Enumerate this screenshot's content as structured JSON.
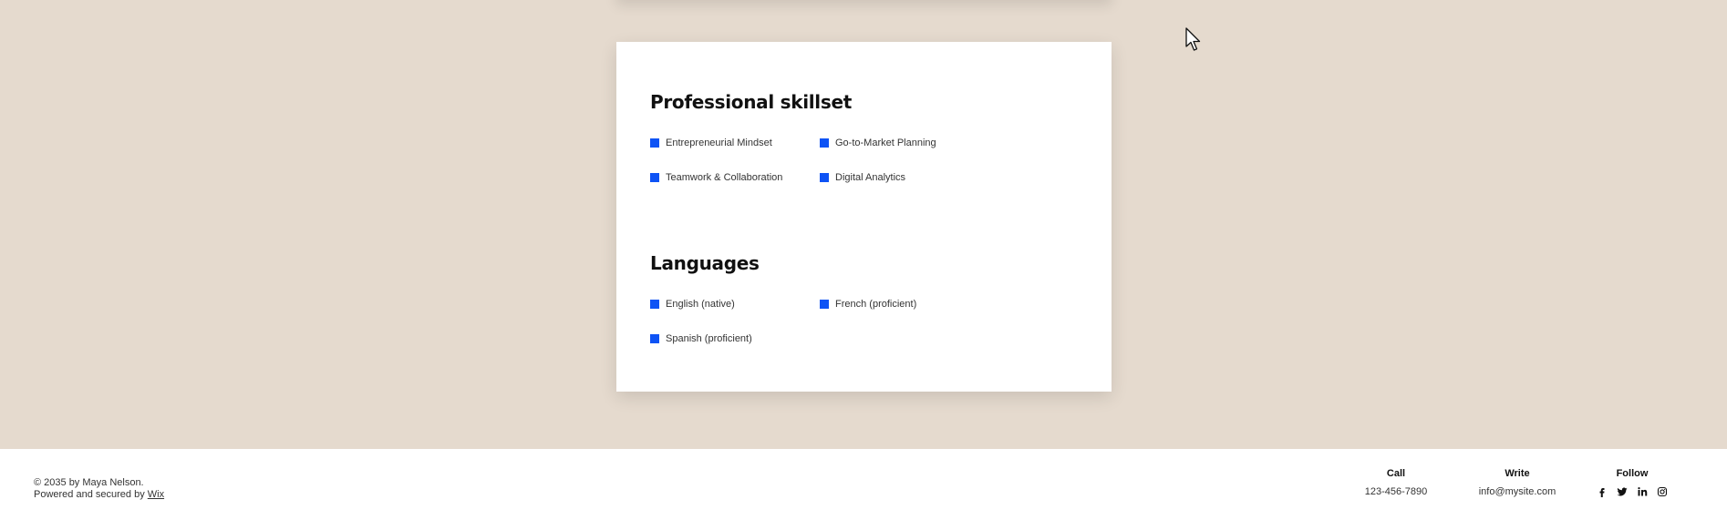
{
  "skills": {
    "title": "Professional skillset",
    "items": [
      "Entrepreneurial Mindset",
      "Go-to-Market Planning",
      "Teamwork & Collaboration",
      "Digital Analytics"
    ]
  },
  "languages": {
    "title": "Languages",
    "items": [
      "English (native)",
      "French (proficient)",
      "Spanish (proficient)"
    ]
  },
  "footer": {
    "copyright_line1": "© 2035 by Maya Nelson.",
    "copyright_line2_prefix": "Powered and secured by",
    "wix_link": "Wix",
    "call_heading": "Call",
    "phone": "123-456-7890",
    "write_heading": "Write",
    "email": "info@mysite.com",
    "follow_heading": "Follow",
    "social_icons": [
      "facebook-icon",
      "twitter-icon",
      "linkedin-icon",
      "instagram-icon"
    ]
  },
  "colors": {
    "page_background": "#e5dace",
    "card_background": "#ffffff",
    "bullet": "#0e53f5",
    "footer_background": "#ffffff"
  }
}
